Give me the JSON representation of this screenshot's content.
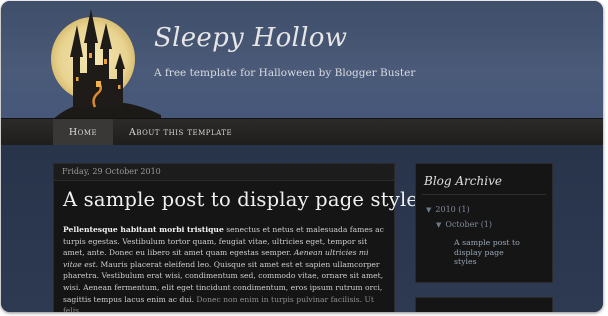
{
  "blog": {
    "title": "Sleepy Hollow",
    "tagline": "A free template for Halloween by Blogger Buster"
  },
  "nav": {
    "items": [
      {
        "label": "Home",
        "active": true
      },
      {
        "label": "About this template",
        "active": false
      }
    ]
  },
  "post": {
    "date": "Friday, 29 October 2010",
    "title": "A sample post to display page styles",
    "body": {
      "bold_lead": "Pellentesque habitant morbi tristique",
      "text1": " senectus et netus et malesuada fames ac turpis egestas. Vestibulum tortor quam, feugiat vitae, ultricies eget, tempor sit amet, ante. Donec eu libero sit amet quam egestas semper. ",
      "italic": "Aenean ultricies mi vitae est.",
      "text2": " Mauris placerat eleifend leo. Quisque sit amet est et sapien ullamcorper pharetra. Vestibulum erat wisi, condimentum sed, commodo  vitae, ornare sit amet, wisi. Aenean fermentum, elit eget tincidunt condimentum, eros ipsum rutrum orci, sagittis tempus lacus enim ac dui. ",
      "dim_tail": "Donec non enim in turpis pulvinar facilisis. Ut felis."
    }
  },
  "sidebar": {
    "archive_title": "Blog Archive",
    "year": "2010",
    "year_count": "(1)",
    "month": "October",
    "month_count": "(1)",
    "post_link": "A sample post to display page styles"
  },
  "colors": {
    "header_bg": "#46577a",
    "nav_bg": "#2d2b2a",
    "post_bg": "#151515",
    "page_bg": "#2e3a4d"
  }
}
